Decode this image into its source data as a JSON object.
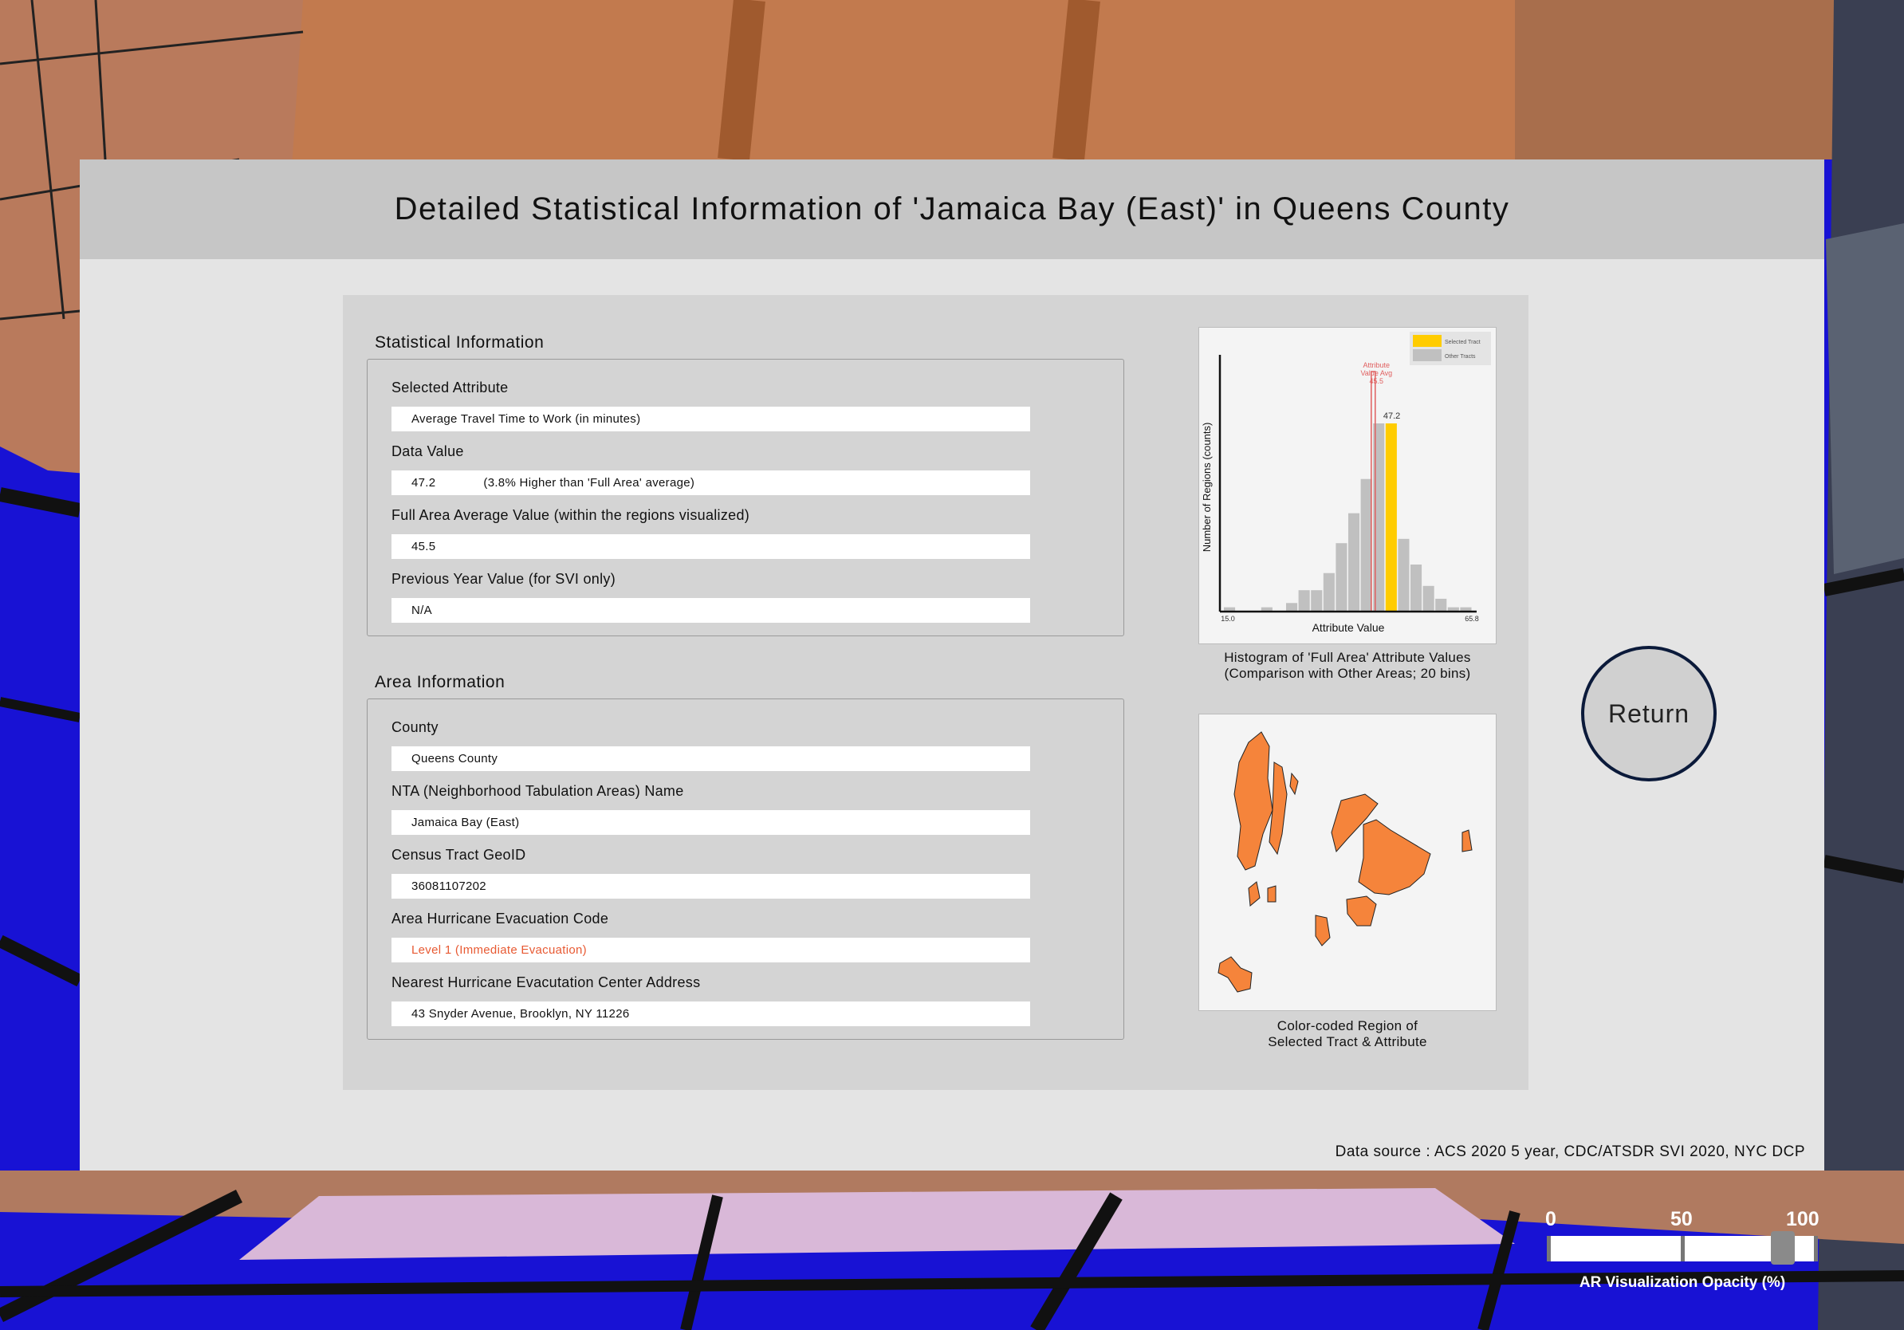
{
  "header": {
    "title": "Detailed Statistical Information of 'Jamaica Bay (East)' in Queens County"
  },
  "statistical_info": {
    "section_title": "Statistical Information",
    "selected_attribute_label": "Selected Attribute",
    "selected_attribute_value": "Average Travel Time to Work (in minutes)",
    "data_value_label": "Data Value",
    "data_value": "47.2",
    "data_value_comparison": "(3.8% Higher than 'Full Area' average)",
    "full_avg_label": "Full Area Average Value (within the regions visualized)",
    "full_avg_value": "45.5",
    "prev_year_label": "Previous Year Value (for SVI only)",
    "prev_year_value": "N/A"
  },
  "area_info": {
    "section_title": "Area Information",
    "county_label": "County",
    "county_value": "Queens County",
    "nta_label": "NTA (Neighborhood Tabulation Areas) Name",
    "nta_value": "Jamaica Bay (East)",
    "geoid_label": "Census Tract GeoID",
    "geoid_value": "36081107202",
    "evac_code_label": "Area Hurricane Evacuation Code",
    "evac_code_value": "Level 1 (Immediate Evacuation)",
    "evac_center_label": "Nearest Hurricane Evacutation Center Address",
    "evac_center_value": "43 Snyder Avenue, Brooklyn, NY 11226"
  },
  "chart_data": {
    "type": "bar",
    "xlabel": "Attribute Value",
    "ylabel": "Number of Regions (counts)",
    "x_min_label": "15.0",
    "x_max_label": "65.8",
    "bins": 20,
    "counts": [
      1,
      0,
      0,
      1,
      0,
      2,
      5,
      5,
      9,
      16,
      23,
      31,
      44,
      44,
      17,
      11,
      6,
      3,
      1,
      1
    ],
    "selected_bin": 13,
    "selected_value_label": "47.2",
    "average_line_value": 45.5,
    "average_label": [
      "Attribute",
      "Value Avg",
      "45.5"
    ],
    "legend": [
      "Selected Tract",
      "Other Tracts"
    ],
    "legend_position": "top-right",
    "colors": {
      "selected": "#ffcc00",
      "other": "#c0c0c0",
      "avg_line": "#e06060"
    }
  },
  "histogram_caption": {
    "line1": "Histogram of 'Full Area' Attribute Values",
    "line2": "(Comparison with Other Areas; 20 bins)"
  },
  "map_caption": {
    "line1": "Color-coded Region of",
    "line2": "Selected Tract & Attribute"
  },
  "map": {
    "fill_color": "#f5843b"
  },
  "return_button": {
    "label": "Return"
  },
  "footer": {
    "source": "Data source : ACS 2020 5 year, CDC/ATSDR SVI 2020, NYC DCP"
  },
  "opacity_slider": {
    "tick_labels": [
      "0",
      "50",
      "100"
    ],
    "value": 87,
    "label": "AR Visualization Opacity (%)"
  }
}
